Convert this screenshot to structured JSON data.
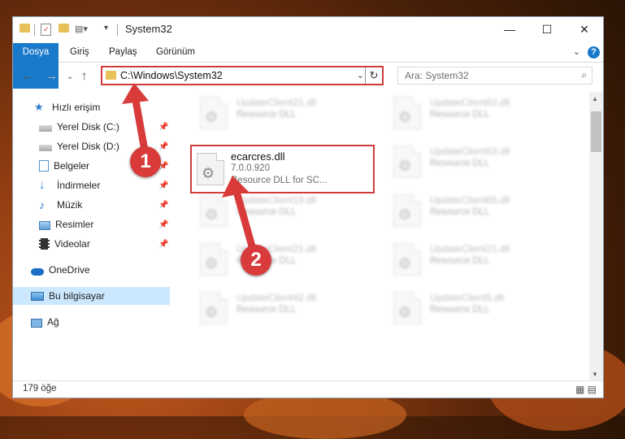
{
  "window": {
    "title": "System32",
    "minimize": "—",
    "maximize": "☐",
    "close": "✕"
  },
  "ribbon": {
    "tabs": [
      "Dosya",
      "Giriş",
      "Paylaş",
      "Görünüm"
    ],
    "help": "?"
  },
  "address": {
    "path": "C:\\Windows\\System32",
    "search_placeholder": "Ara: System32"
  },
  "sidebar": {
    "items": [
      {
        "label": "Hızlı erişim",
        "icon": "star-icon"
      },
      {
        "label": "Yerel Disk (C:)",
        "icon": "drive-icon"
      },
      {
        "label": "Yerel Disk (D:)",
        "icon": "drive-icon"
      },
      {
        "label": "Belgeler",
        "icon": "documents-icon"
      },
      {
        "label": "İndirmeler",
        "icon": "download-icon"
      },
      {
        "label": "Müzik",
        "icon": "music-icon"
      },
      {
        "label": "Resimler",
        "icon": "pictures-icon"
      },
      {
        "label": "Videolar",
        "icon": "video-icon"
      },
      {
        "label": "OneDrive",
        "icon": "cloud-icon"
      },
      {
        "label": "Bu bilgisayar",
        "icon": "computer-icon"
      },
      {
        "label": "Ağ",
        "icon": "network-icon"
      }
    ]
  },
  "files": {
    "highlighted": {
      "name": "ecarcres.dll",
      "version": "7.0.0.920",
      "description": "Resource DLL for SC..."
    },
    "blurred": [
      {
        "name": "UpdateClient21.dll",
        "type": "Resource DLL"
      },
      {
        "name": "UpdateClient63.dll",
        "type": "Resource DLL"
      },
      {
        "name": "UpdateClient63.dll",
        "type": "Resource DLL"
      },
      {
        "name": "UpdateClient19.dll",
        "type": "Resource DLL"
      },
      {
        "name": "UpdateClient65.dll",
        "type": "Resource DLL"
      },
      {
        "name": "UpdateClient21.dll",
        "type": "Resource DLL"
      },
      {
        "name": "UpdateClient21.dll",
        "type": "Resource DLL"
      },
      {
        "name": "UpdateClient42.dll",
        "type": "Resource DLL"
      },
      {
        "name": "UpdateClient5.dll",
        "type": "Resource DLL"
      }
    ]
  },
  "status": {
    "count": "179 öğe"
  },
  "annotations": {
    "step1": "1",
    "step2": "2"
  },
  "colors": {
    "accent": "#1979ca",
    "highlight": "#d23b3b"
  }
}
